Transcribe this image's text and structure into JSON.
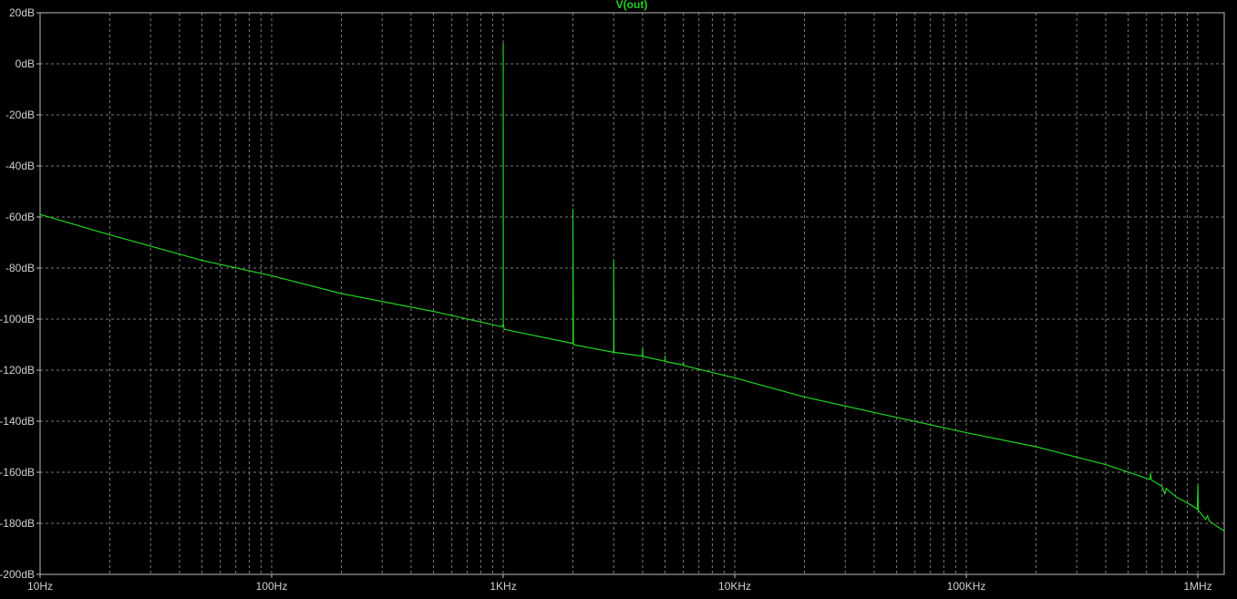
{
  "colors": {
    "background": "#000000",
    "frame": "#bdbdbd",
    "grid": "#7a7a7a",
    "trace": "#21d321",
    "text": "#cfcfcf"
  },
  "chart_data": {
    "type": "line",
    "title": "V(out)",
    "x_scale": "log",
    "xlim": [
      10,
      1300000
    ],
    "ylim": [
      -200,
      20
    ],
    "grid": true,
    "x_ticks": [
      {
        "value": 10,
        "label": "10Hz"
      },
      {
        "value": 100,
        "label": "100Hz"
      },
      {
        "value": 1000,
        "label": "1KHz"
      },
      {
        "value": 10000,
        "label": "10KHz"
      },
      {
        "value": 100000,
        "label": "100KHz"
      },
      {
        "value": 1000000,
        "label": "1MHz"
      }
    ],
    "y_ticks": [
      {
        "value": 20,
        "label": "20dB"
      },
      {
        "value": 0,
        "label": "0dB"
      },
      {
        "value": -20,
        "label": "-20dB"
      },
      {
        "value": -40,
        "label": "-40dB"
      },
      {
        "value": -60,
        "label": "-60dB"
      },
      {
        "value": -80,
        "label": "-80dB"
      },
      {
        "value": -100,
        "label": "-100dB"
      },
      {
        "value": -120,
        "label": "-120dB"
      },
      {
        "value": -140,
        "label": "-140dB"
      },
      {
        "value": -160,
        "label": "-160dB"
      },
      {
        "value": -180,
        "label": "-180dB"
      },
      {
        "value": -200,
        "label": "-200dB"
      }
    ],
    "series": [
      {
        "name": "V(out)",
        "x": [
          10,
          20,
          50,
          100,
          200,
          500,
          990,
          1000,
          1000,
          1001,
          1010,
          1990,
          2000,
          2000,
          2010,
          2990,
          3000,
          3000,
          3010,
          3990,
          4000,
          4010,
          4990,
          5000,
          5010,
          5990,
          6000,
          6010,
          10000,
          20000,
          50000,
          100000,
          200000,
          400000,
          620000,
          625000,
          630000,
          700000,
          720000,
          730000,
          800000,
          900000,
          980000,
          995000,
          1000000,
          1005000,
          1030000,
          1080000,
          1100000,
          1120000,
          1200000,
          1300000
        ],
        "y": [
          -59,
          -67,
          -77,
          -83,
          -90,
          -97,
          -103,
          -102,
          8,
          -102,
          -104,
          -109.5,
          -109,
          -57,
          -110,
          -113,
          -112,
          -77,
          -113,
          -114.5,
          -111.5,
          -114.6,
          -116.5,
          -114.5,
          -116.6,
          -118,
          -117,
          -118.2,
          -123,
          -130.5,
          -138.5,
          -144.5,
          -150,
          -157,
          -162.8,
          -160.5,
          -163,
          -165.5,
          -168.5,
          -166.3,
          -169.5,
          -172,
          -174,
          -174.5,
          -165,
          -175,
          -176,
          -178.5,
          -177,
          -179,
          -181,
          -183
        ]
      }
    ]
  }
}
